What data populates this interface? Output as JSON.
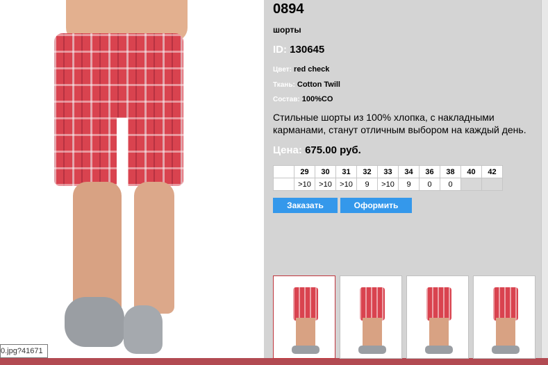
{
  "product": {
    "title": "0894",
    "type": "шорты",
    "id_label": "ID:",
    "id_value": "130645",
    "attributes": [
      {
        "label": "Цвет:",
        "value": "red check"
      },
      {
        "label": "Ткань:",
        "value": "Cotton Twill"
      },
      {
        "label": "Состав:",
        "value": "100%CO"
      }
    ],
    "description": "Стильные шорты из 100% хлопка, с накладными карманами, станут отличным выбором на каждый день.",
    "price_label": "Цена:",
    "price_value": "675.00 руб."
  },
  "sizes": {
    "headers": [
      "29",
      "30",
      "31",
      "32",
      "33",
      "34",
      "36",
      "38",
      "40",
      "42"
    ],
    "stock": [
      ">10",
      ">10",
      ">10",
      "9",
      ">10",
      "9",
      "0",
      "0",
      "",
      ""
    ]
  },
  "buttons": {
    "order": "Заказать",
    "checkout": "Оформить"
  },
  "image_tooltip": "0.jpg?41671",
  "thumbnails": [
    {
      "name": "front",
      "active": true
    },
    {
      "name": "side",
      "active": false
    },
    {
      "name": "front-2",
      "active": false
    },
    {
      "name": "side-2",
      "active": false
    }
  ],
  "colors": {
    "panel_bg": "#d4d4d4",
    "button_bg": "#3498eb",
    "active_thumb_border": "#c0353c",
    "shorts": "#d9434f"
  }
}
